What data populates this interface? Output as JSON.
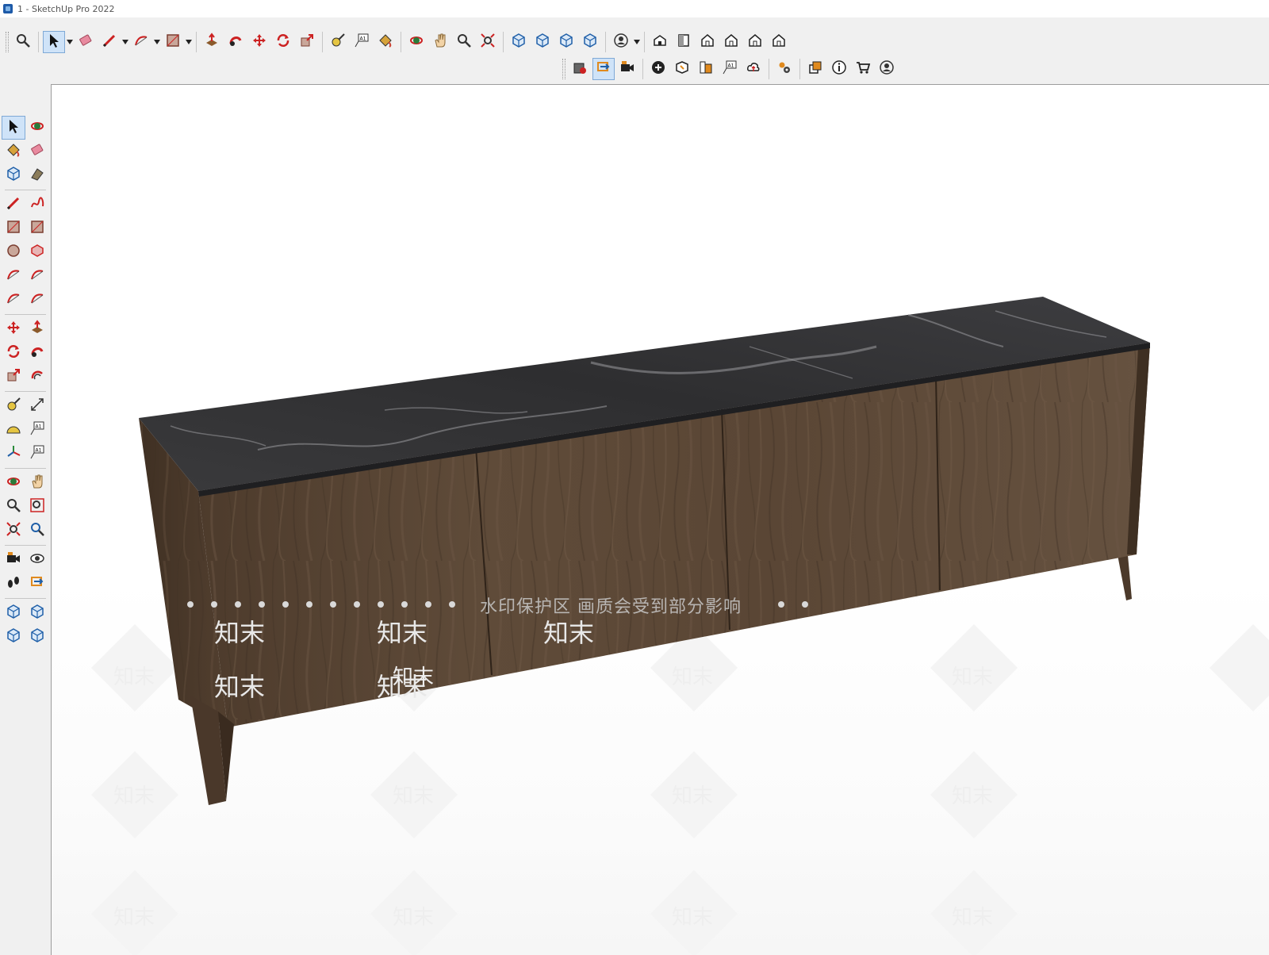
{
  "window": {
    "title": "1 - SketchUp Pro 2022"
  },
  "top_toolbar": [
    {
      "name": "search-icon",
      "group": 0
    },
    {
      "name": "select-arrow-icon",
      "group": 1,
      "active": true,
      "dropdown": true
    },
    {
      "name": "eraser-icon",
      "group": 1
    },
    {
      "name": "pencil-line-icon",
      "group": 1,
      "dropdown": true
    },
    {
      "name": "arc-icon",
      "group": 1,
      "dropdown": true
    },
    {
      "name": "rectangle-icon",
      "group": 1,
      "dropdown": true
    },
    {
      "name": "push-pull-icon",
      "group": 2
    },
    {
      "name": "follow-me-icon",
      "group": 2
    },
    {
      "name": "move-icon",
      "group": 2
    },
    {
      "name": "rotate-icon",
      "group": 2
    },
    {
      "name": "scale-icon",
      "group": 2
    },
    {
      "name": "tape-measure-icon",
      "group": 3
    },
    {
      "name": "text-label-icon",
      "group": 3
    },
    {
      "name": "paint-bucket-icon",
      "group": 3
    },
    {
      "name": "orbit-icon",
      "group": 4
    },
    {
      "name": "pan-hand-icon",
      "group": 4
    },
    {
      "name": "zoom-icon",
      "group": 4
    },
    {
      "name": "zoom-extents-icon",
      "group": 4
    },
    {
      "name": "3d-warehouse-icon",
      "group": 5
    },
    {
      "name": "extension-warehouse-icon",
      "group": 5
    },
    {
      "name": "layout-icon",
      "group": 5
    },
    {
      "name": "extension-manager-icon",
      "group": 5
    },
    {
      "name": "user-account-icon",
      "group": 6,
      "dropdown": true
    },
    {
      "name": "view-iso-icon",
      "group": 7
    },
    {
      "name": "view-top-icon",
      "group": 7
    },
    {
      "name": "view-front-icon",
      "group": 7
    },
    {
      "name": "view-right-icon",
      "group": 7
    },
    {
      "name": "view-back-icon",
      "group": 7
    },
    {
      "name": "view-left-icon",
      "group": 7
    }
  ],
  "second_toolbar": [
    {
      "name": "solid-tools-icon",
      "group": 0
    },
    {
      "name": "section-plane-icon",
      "group": 0,
      "active": true
    },
    {
      "name": "camera-scenes-icon",
      "group": 0
    },
    {
      "name": "add-location-icon",
      "group": 1
    },
    {
      "name": "geo-icon",
      "group": 1
    },
    {
      "name": "materials-icon",
      "group": 1
    },
    {
      "name": "checker-texture-icon",
      "group": 1
    },
    {
      "name": "cloud-upload-icon",
      "group": 1
    },
    {
      "name": "settings-gears-icon",
      "group": 2
    },
    {
      "name": "share-window-icon",
      "group": 3
    },
    {
      "name": "info-icon",
      "group": 3
    },
    {
      "name": "cart-icon",
      "group": 3
    },
    {
      "name": "profile-icon",
      "group": 3
    }
  ],
  "left_toolbar": [
    [
      "select-icon",
      "orbit-small-icon"
    ],
    [
      "paint-small-icon",
      "eraser-small-icon"
    ],
    [
      "component-icon",
      "tag-icon"
    ],
    "sep",
    [
      "line-icon",
      "freehand-icon"
    ],
    [
      "rectangle-small-icon",
      "rotated-rect-icon"
    ],
    [
      "circle-icon",
      "polygon-icon"
    ],
    [
      "arc-small-icon",
      "two-point-arc-icon"
    ],
    [
      "three-point-arc-icon",
      "pie-icon"
    ],
    "sep",
    [
      "move-small-icon",
      "pushpull-small-icon"
    ],
    [
      "rotate-small-icon",
      "followme-small-icon"
    ],
    [
      "scale-small-icon",
      "offset-icon"
    ],
    "sep",
    [
      "tape-small-icon",
      "dimension-icon"
    ],
    [
      "protractor-icon",
      "text-small-icon"
    ],
    [
      "axes-icon",
      "3d-text-icon"
    ],
    "sep",
    [
      "orbit-alt-icon",
      "pan-small-icon"
    ],
    [
      "zoom-small-icon",
      "zoom-window-icon"
    ],
    [
      "zoom-extents-small-icon",
      "previous-view-icon"
    ],
    "sep",
    [
      "position-camera-icon",
      "look-around-icon"
    ],
    [
      "walk-icon",
      "section-small-icon"
    ],
    "sep",
    [
      "warehouse-small-icon",
      "extension-small-icon"
    ],
    [
      "layout-small-icon",
      "ext-manager-small-icon"
    ]
  ],
  "viewport": {
    "watermark_text": "水印保护区  画质会受到部分影响",
    "watermark_logo": "知末",
    "model": "sideboard with black marble top and walnut wood cabinet"
  },
  "colors": {
    "accent_active": "#cfe3f8",
    "wood": "#5e4a38",
    "marble": "#2c2c2e",
    "icon_red": "#cc2222",
    "icon_blue": "#1f5fa8"
  }
}
